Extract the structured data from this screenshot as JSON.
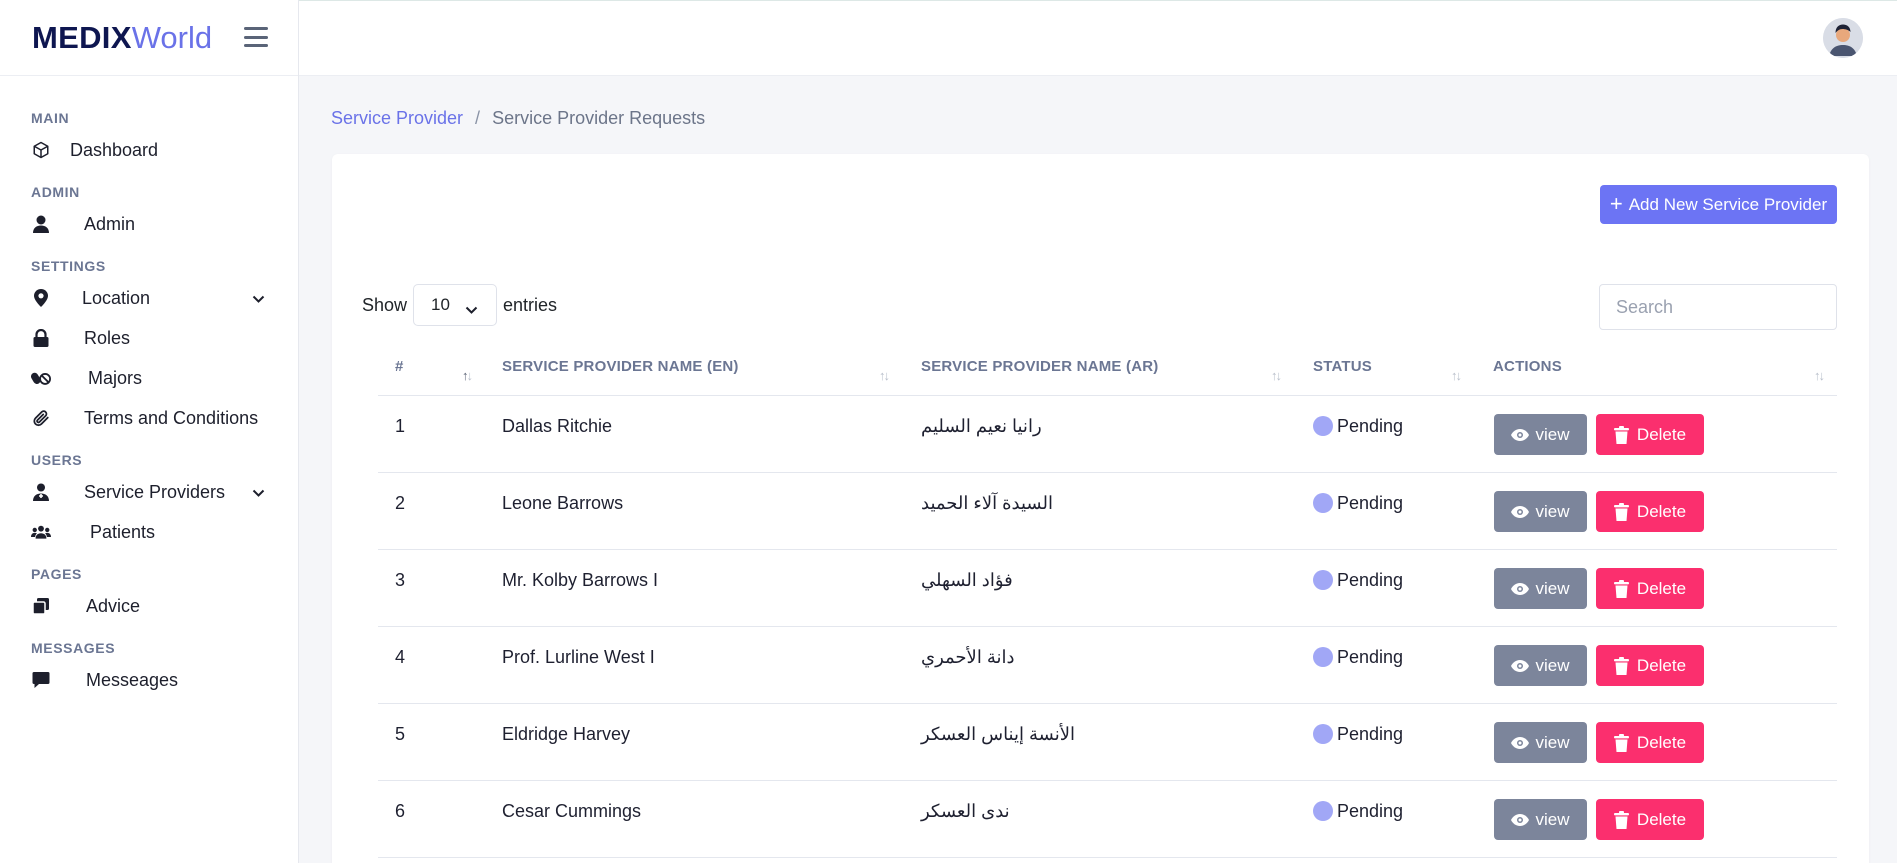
{
  "brand": {
    "part1": "MEDIX",
    "part2": "World"
  },
  "sidebar": {
    "sections": [
      {
        "title": "MAIN",
        "items": [
          {
            "label": "Dashboard",
            "icon": "cube-icon"
          }
        ]
      },
      {
        "title": "ADMIN",
        "items": [
          {
            "label": "Admin",
            "icon": "user-icon"
          }
        ]
      },
      {
        "title": "SETTINGS",
        "items": [
          {
            "label": "Location",
            "icon": "map-pin-icon",
            "has_submenu": true
          },
          {
            "label": "Roles",
            "icon": "lock-icon"
          },
          {
            "label": "Majors",
            "icon": "pills-icon"
          },
          {
            "label": "Terms and Conditions",
            "icon": "paperclip-icon"
          }
        ]
      },
      {
        "title": "USERS",
        "items": [
          {
            "label": "Service Providers",
            "icon": "user-doctor-icon",
            "has_submenu": true
          },
          {
            "label": "Patients",
            "icon": "users-icon"
          }
        ]
      },
      {
        "title": "PAGES",
        "items": [
          {
            "label": "Advice",
            "icon": "copy-icon"
          }
        ]
      },
      {
        "title": "MESSAGES",
        "items": [
          {
            "label": "Messeages",
            "icon": "message-icon"
          }
        ]
      }
    ]
  },
  "breadcrumb": {
    "parent": "Service Provider",
    "separator": "/",
    "current": "Service Provider Requests"
  },
  "toolbar": {
    "add_label": "Add New Service Provider"
  },
  "table_controls": {
    "show_label": "Show",
    "page_size": "10",
    "entries_label": "entries",
    "search_placeholder": "Search"
  },
  "table": {
    "columns": [
      "#",
      "SERVICE PROVIDER NAME (EN)",
      "SERVICE PROVIDER NAME (AR)",
      "STATUS",
      "ACTIONS"
    ],
    "view_label": "view",
    "delete_label": "Delete",
    "rows": [
      {
        "num": "1",
        "name_en": "Dallas Ritchie",
        "name_ar": "رانيا نعيم السليم",
        "status": "Pending"
      },
      {
        "num": "2",
        "name_en": "Leone Barrows",
        "name_ar": "السيدة آلاء الحميد",
        "status": "Pending"
      },
      {
        "num": "3",
        "name_en": "Mr. Kolby Barrows I",
        "name_ar": "فؤاد السهلي",
        "status": "Pending"
      },
      {
        "num": "4",
        "name_en": "Prof. Lurline West I",
        "name_ar": "دانة الأحمري",
        "status": "Pending"
      },
      {
        "num": "5",
        "name_en": "Eldridge Harvey",
        "name_ar": "الأنسة إيناس العسكر",
        "status": "Pending"
      },
      {
        "num": "6",
        "name_en": "Cesar Cummings",
        "name_ar": "ندى العسكر",
        "status": "Pending"
      }
    ]
  },
  "colors": {
    "accent": "#6c74f4",
    "delete": "#fb2f6e",
    "view": "#7c859b",
    "status_dot": "#a1a7f6"
  }
}
